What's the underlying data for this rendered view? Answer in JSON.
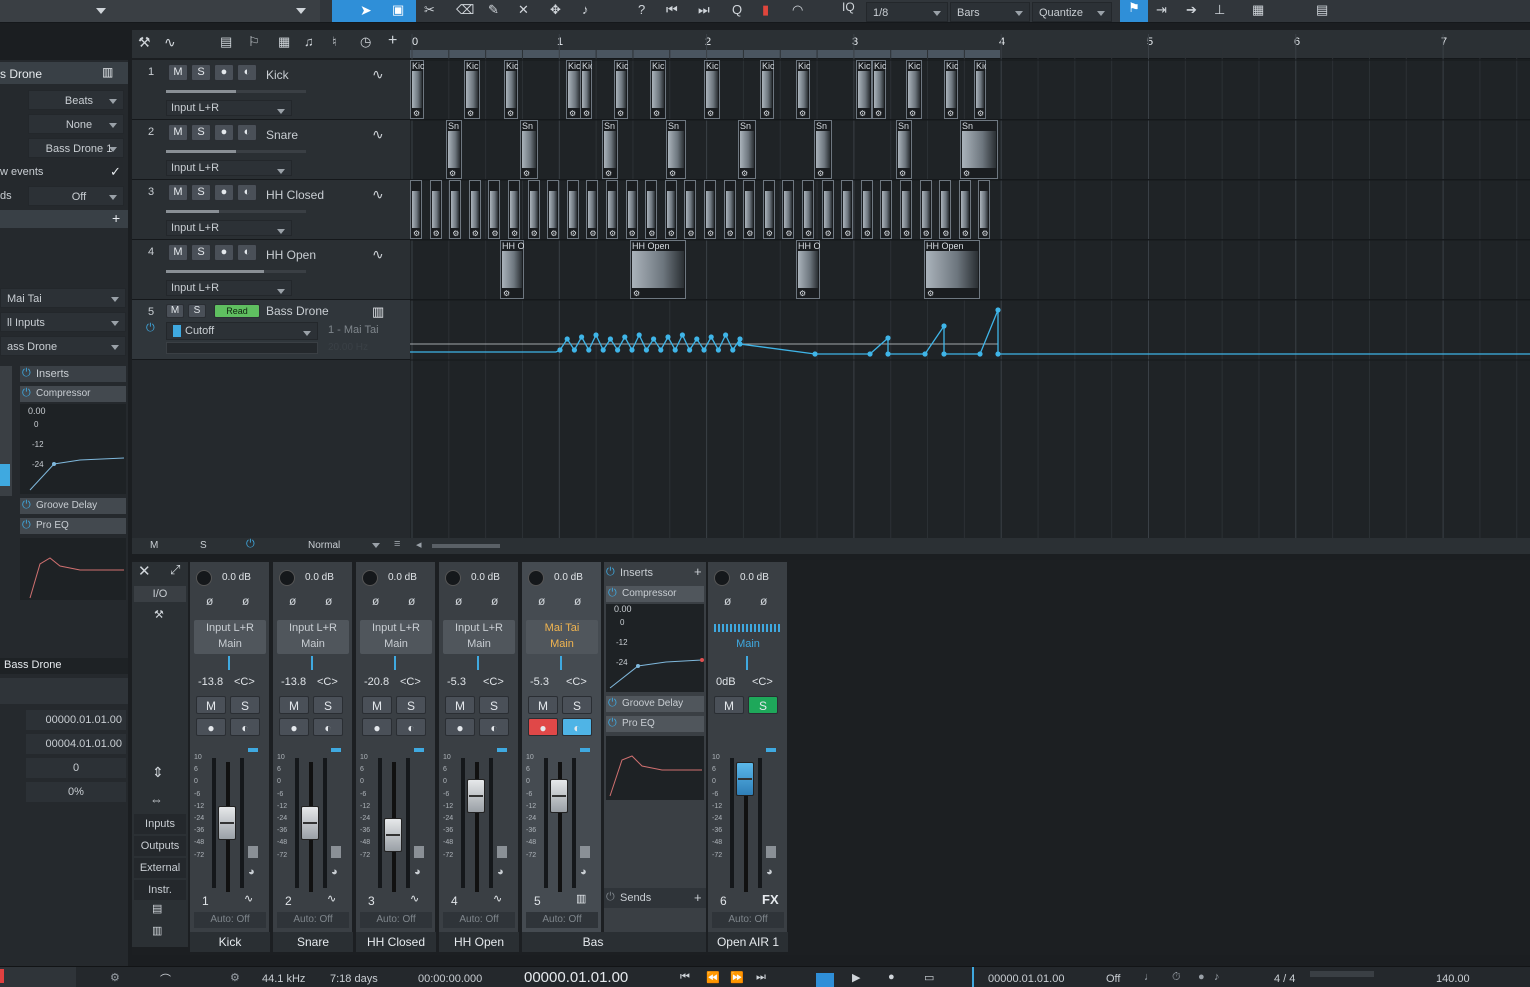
{
  "toolbar": {
    "grid_value": "1/8",
    "timebase": "Bars",
    "quantize": "Quantize",
    "iq": "IQ"
  },
  "inspector": {
    "track_name": "s Drone",
    "timebase": "Beats",
    "groove": "None",
    "layer": "Bass Drone 1",
    "follow_events": "w events",
    "records": "ds",
    "records_value": "Off",
    "instrument": "Mai Tai",
    "input": "ll Inputs",
    "output": "ass Drone",
    "inserts_title": "Inserts",
    "insert1": "Compressor",
    "insert2": "Groove Delay",
    "insert3": "Pro EQ",
    "comp_value": "0.00",
    "comp_scale": [
      "0",
      "-12",
      "-24"
    ],
    "footer_name": "Bass Drone",
    "start": "00000.01.01.00",
    "end": "00004.01.01.00",
    "field3": "0",
    "field4": "0%"
  },
  "ruler": {
    "bars": [
      "0",
      "1",
      "2",
      "3",
      "4",
      "5",
      "6",
      "7"
    ]
  },
  "tracks": [
    {
      "num": "1",
      "name": "Kick",
      "input": "Input L+R",
      "clip_label": "Kic"
    },
    {
      "num": "2",
      "name": "Snare",
      "input": "Input L+R",
      "clip_label": "Sn"
    },
    {
      "num": "3",
      "name": "HH Closed",
      "input": "Input L+R",
      "clip_label": ""
    },
    {
      "num": "4",
      "name": "HH Open",
      "input": "Input L+R",
      "clip_label": "HH Open"
    },
    {
      "num": "5",
      "name": "Bass Drone",
      "automation": "Cutoff",
      "automation_target": "1 - Mai Tai",
      "auto_mode": "Read",
      "automation_value": "20.00 Hz"
    }
  ],
  "track_buttons": {
    "mute": "M",
    "solo": "S"
  },
  "console_header": {
    "m": "M",
    "s": "S",
    "mode": "Normal"
  },
  "mixer": {
    "left_panel": [
      "I/O",
      "Inputs",
      "Outputs",
      "External",
      "Instr."
    ],
    "strips": [
      {
        "name": "Kick",
        "num": "1",
        "gain": "0.0 dB",
        "input": "Input L+R",
        "output": "Main",
        "volume": "-13.8",
        "pan": "<C>",
        "auto": "Auto: Off"
      },
      {
        "name": "Snare",
        "num": "2",
        "gain": "0.0 dB",
        "input": "Input L+R",
        "output": "Main",
        "volume": "-13.8",
        "pan": "<C>",
        "auto": "Auto: Off"
      },
      {
        "name": "HH Closed",
        "num": "3",
        "gain": "0.0 dB",
        "input": "Input L+R",
        "output": "Main",
        "volume": "-20.8",
        "pan": "<C>",
        "auto": "Auto: Off"
      },
      {
        "name": "HH Open",
        "num": "4",
        "gain": "0.0 dB",
        "input": "Input L+R",
        "output": "Main",
        "volume": "-5.3",
        "pan": "<C>",
        "auto": "Auto: Off"
      },
      {
        "name": "Bass Drone",
        "num": "5",
        "gain": "0.0 dB",
        "input": "Mai Tai",
        "output": "Main",
        "volume": "-5.3",
        "pan": "<C>",
        "auto": "Auto: Off"
      }
    ],
    "fx_strip": {
      "name": "Open AIR 1",
      "num": "6",
      "gain": "0.0 dB",
      "output": "Main",
      "volume": "0dB",
      "pan": "<C>",
      "auto": "Auto: Off",
      "fx": "FX"
    },
    "inserts_panel": {
      "title": "Inserts",
      "insert1": "Compressor",
      "value": "0.00",
      "scale": [
        "0",
        "-12",
        "-24"
      ],
      "insert2": "Groove Delay",
      "insert3": "Pro EQ",
      "sends": "Sends"
    },
    "fader_scale": [
      "10",
      "6",
      "0",
      "-6",
      "-12",
      "-24",
      "-36",
      "-48",
      "-72"
    ],
    "fader_levels": [
      0.54,
      0.54,
      0.42,
      0.82,
      0.82,
      1.0
    ],
    "mute": "M",
    "solo": "S"
  },
  "transport": {
    "sample_rate": "44.1 kHz",
    "duration": "7:18 days",
    "time": "00:00:00.000",
    "position": "00000.01.01.00",
    "loop_start": "00000.01.01.00",
    "off": "Off",
    "signature": "4 / 4",
    "tempo": "140.00"
  }
}
